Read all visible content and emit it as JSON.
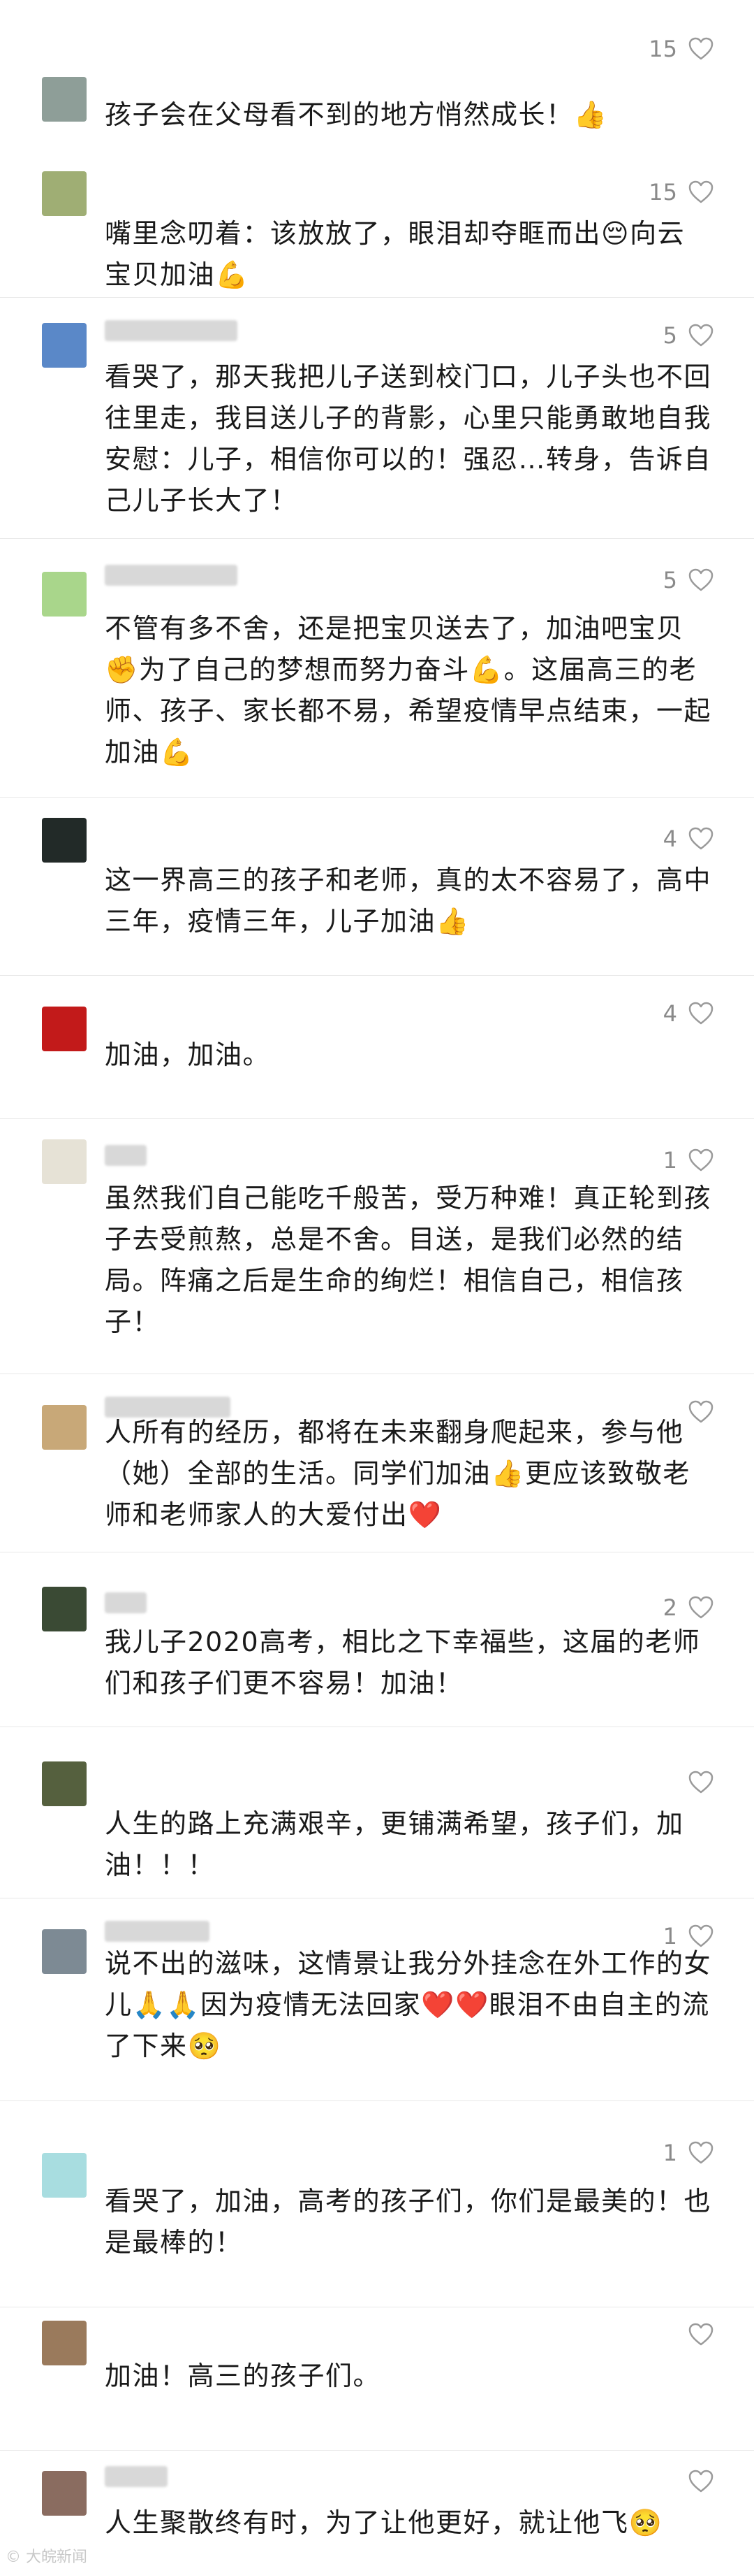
{
  "watermark": "© 大皖新闻",
  "comments": [
    {
      "likes": "15",
      "text": "孩子会在父母看不到的地方悄然成长！👍",
      "avatar_color": "#8e9e98"
    },
    {
      "likes": "15",
      "text": "嘴里念叨着：该放放了，眼泪却夺眶而出😔向云宝贝加油💪",
      "avatar_color": "#9fae74"
    },
    {
      "likes": "5",
      "text": "看哭了，那天我把儿子送到校门口，儿子头也不回往里走，我目送儿子的背影，心里只能勇敢地自我安慰：儿子，相信你可以的！强忍…转身，告诉自己儿子长大了！",
      "avatar_color": "#5a88c8"
    },
    {
      "likes": "5",
      "text": "不管有多不舍，还是把宝贝送去了，加油吧宝贝✊为了自己的梦想而努力奋斗💪。这届高三的老师、孩子、家长都不易，希望疫情早点结束，一起加油💪",
      "avatar_color": "#a9d68b"
    },
    {
      "likes": "4",
      "text": "这一界高三的孩子和老师，真的太不容易了，高中三年，疫情三年，儿子加油👍",
      "avatar_color": "#222a28"
    },
    {
      "likes": "4",
      "text": "加油，加油。",
      "avatar_color": "#c21a1a"
    },
    {
      "likes": "1",
      "text": "虽然我们自己能吃千般苦，受万种难！真正轮到孩子去受煎熬，总是不舍。目送，是我们必然的结局。阵痛之后是生命的绚烂！相信自己，相信孩子！",
      "avatar_color": "#e6e2d6"
    },
    {
      "likes": "",
      "text": "人所有的经历，都将在未来翻身爬起来，参与他（她）全部的生活。同学们加油👍更应该致敬老师和老师家人的大爱付出❤️",
      "avatar_color": "#c8a878"
    },
    {
      "likes": "2",
      "text": "我儿子2020高考，相比之下幸福些，这届的老师们和孩子们更不容易！加油！",
      "avatar_color": "#3a4a34"
    },
    {
      "likes": "",
      "text": "人生的路上充满艰辛，更铺满希望，孩子们，加油！！！",
      "avatar_color": "#55603e"
    },
    {
      "likes": "1",
      "text": "说不出的滋味，这情景让我分外挂念在外工作的女儿🙏🙏因为疫情无法回家❤️❤️眼泪不由自主的流了下来🥺",
      "avatar_color": "#7d8a94"
    },
    {
      "likes": "1",
      "text": "看哭了，加油，高考的孩子们，你们是最美的！也是最棒的！",
      "avatar_color": "#a8dde0"
    },
    {
      "likes": "",
      "text": "加油！高三的孩子们。",
      "avatar_color": "#9a7a5c"
    },
    {
      "likes": "",
      "text": "人生聚散终有时，为了让他更好，就让他飞🥺",
      "avatar_color": "#8a6c60"
    }
  ]
}
